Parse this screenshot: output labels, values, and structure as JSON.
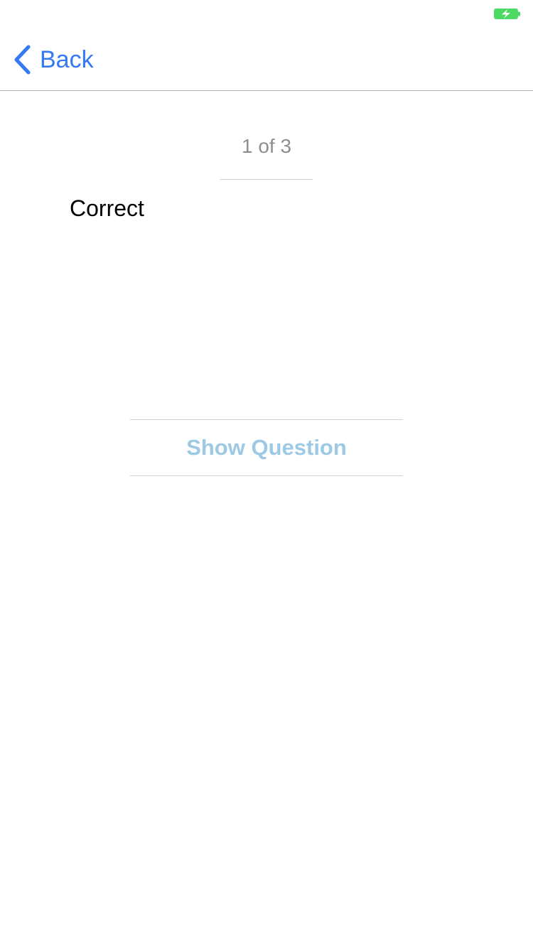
{
  "status_bar": {
    "battery_icon": "battery-charging-icon",
    "battery_color": "#4cd964"
  },
  "nav": {
    "back_icon": "chevron-left-icon",
    "back_label": "Back",
    "accent_color": "#3478f6"
  },
  "card": {
    "counter": "1 of 3",
    "answer_text": "Correct",
    "show_question_label": "Show Question",
    "button_color": "#9cc9e4"
  }
}
